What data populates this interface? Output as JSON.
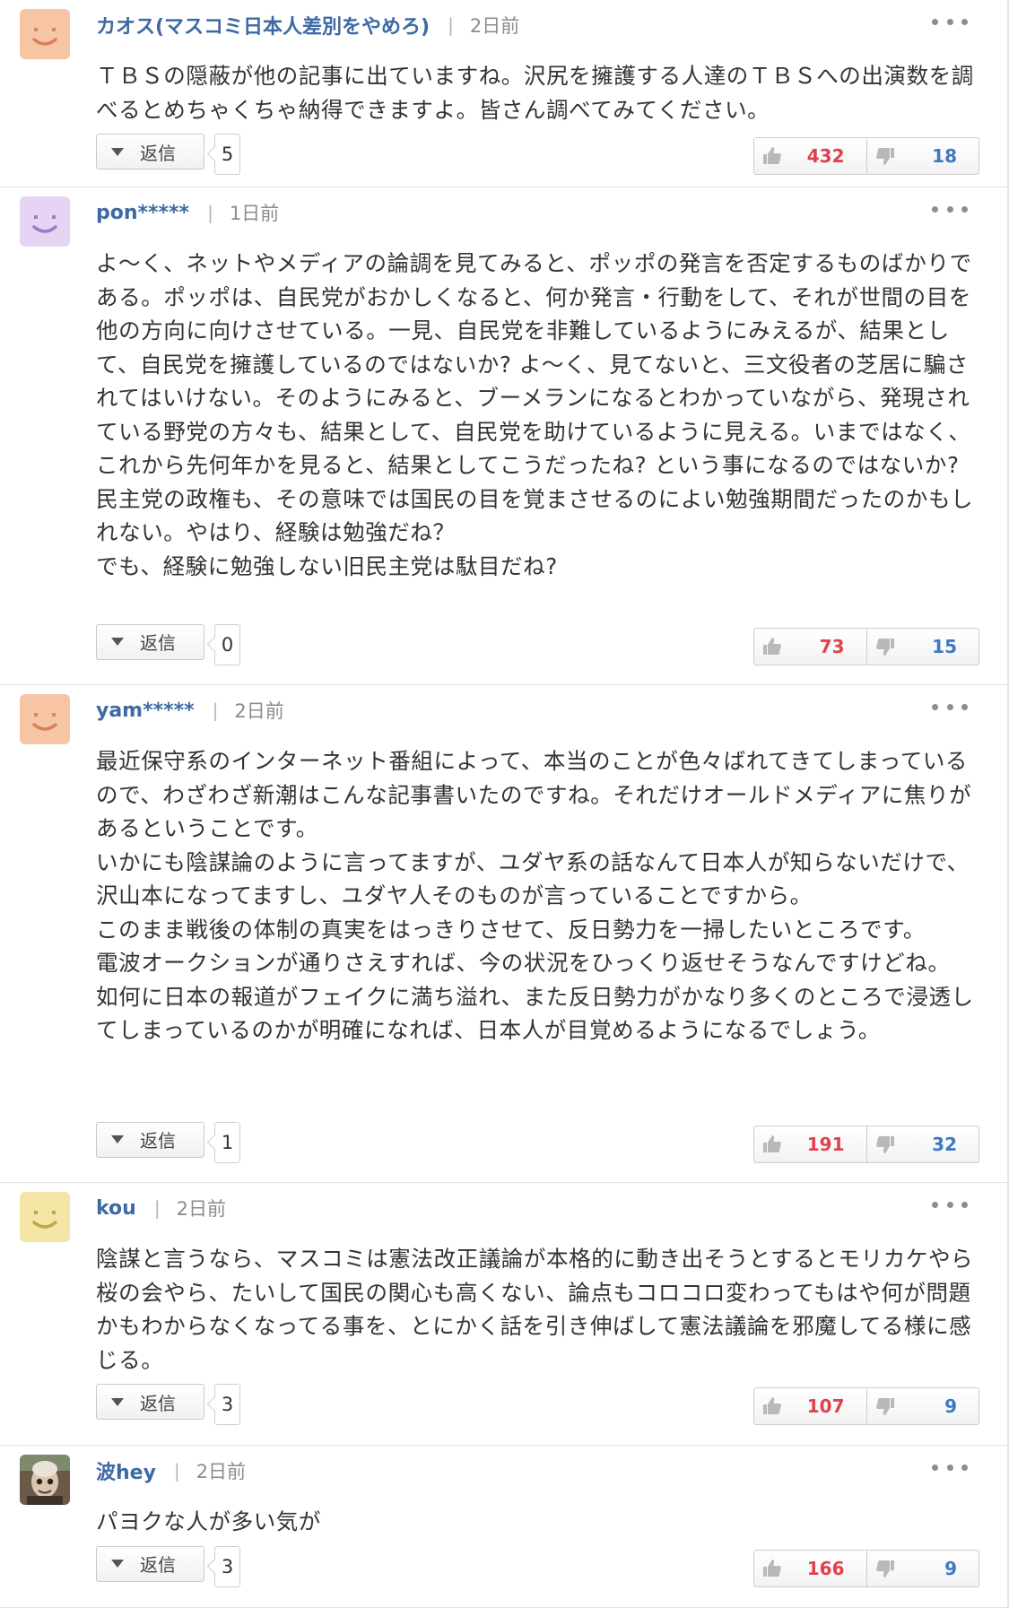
{
  "comments": [
    {
      "username": "カオス(マスコミ日本人差別をやめろ)",
      "separator": "|",
      "time": "2日前",
      "avatar": {
        "type": "smiley",
        "bg": "#f6c6a4",
        "eye": "#c88a62",
        "mouth": "#d8805a"
      },
      "text": "ＴＢＳの隠蔽が他の記事に出ていますね。沢尻を擁護する人達のＴＢＳへの出演数を調べるとめちゃくちゃ納得できますよ。皆さん調べてみてください。",
      "reply_label": "返信",
      "reply_count": "5",
      "likes": "432",
      "dislikes": "18"
    },
    {
      "username": "pon*****",
      "separator": "|",
      "time": "1日前",
      "avatar": {
        "type": "smiley",
        "bg": "#e6d4f3",
        "eye": "#a27ac8",
        "mouth": "#a27ac8"
      },
      "text": "よ〜く、ネットやメディアの論調を見てみると、ポッポの発言を否定するものばかりである。ポッポは、自民党がおかしくなると、何か発言・行動をして、それが世間の目を他の方向に向けさせている。一見、自民党を非難しているようにみえるが、結果として、自民党を擁護しているのではないか? よ〜く、見てないと、三文役者の芝居に騙されてはいけない。そのようにみると、ブーメランになるとわかっていながら、発現されている野党の方々も、結果として、自民党を助けているように見える。いまではなく、これから先何年かを見ると、結果としてこうだったね? という事になるのではないか?\n民主党の政権も、その意味では国民の目を覚まさせるのによい勉強期間だったのかもしれない。やはり、経験は勉強だね？\nでも、経験に勉強しない旧民主党は駄目だね?",
      "reply_label": "返信",
      "reply_count": "0",
      "likes": "73",
      "dislikes": "15"
    },
    {
      "username": "yam*****",
      "separator": "|",
      "time": "2日前",
      "avatar": {
        "type": "smiley",
        "bg": "#f6c6a4",
        "eye": "#c88a62",
        "mouth": "#d8805a"
      },
      "text": "最近保守系のインターネット番組によって、本当のことが色々ばれてきてしまっているので、わざわざ新潮はこんな記事書いたのですね。それだけオールドメディアに焦りがあるということです。\nいかにも陰謀論のように言ってますが、ユダヤ系の話なんて日本人が知らないだけで、沢山本になってますし、ユダヤ人そのものが言っていることですから。\nこのまま戦後の体制の真実をはっきりさせて、反日勢力を一掃したいところです。\n電波オークションが通りさえすれば、今の状況をひっくり返せそうなんですけどね。\n如何に日本の報道がフェイクに満ち溢れ、また反日勢力がかなり多くのところで浸透してしまっているのかが明確になれば、日本人が目覚めるようになるでしょう。",
      "reply_label": "返信",
      "reply_count": "1",
      "likes": "191",
      "dislikes": "32"
    },
    {
      "username": "kou",
      "separator": "|",
      "time": "2日前",
      "avatar": {
        "type": "smiley",
        "bg": "#f3e6a6",
        "eye": "#c2a64e",
        "mouth": "#c2a64e"
      },
      "text": "陰謀と言うなら、マスコミは憲法改正議論が本格的に動き出そうとするとモリカケやら桜の会やら、たいして国民の関心も高くない、論点もコロコロ変わってもはや何が問題かもわからなくなってる事を、とにかく話を引き伸ばして憲法議論を邪魔してる様に感じる。",
      "reply_label": "返信",
      "reply_count": "3",
      "likes": "107",
      "dislikes": "9"
    },
    {
      "username": "波hey",
      "separator": "|",
      "time": "2日前",
      "avatar": {
        "type": "photo",
        "bg": "#6b5a48"
      },
      "text": "パヨクな人が多い気が",
      "reply_label": "返信",
      "reply_count": "3",
      "likes": "166",
      "dislikes": "9"
    }
  ]
}
